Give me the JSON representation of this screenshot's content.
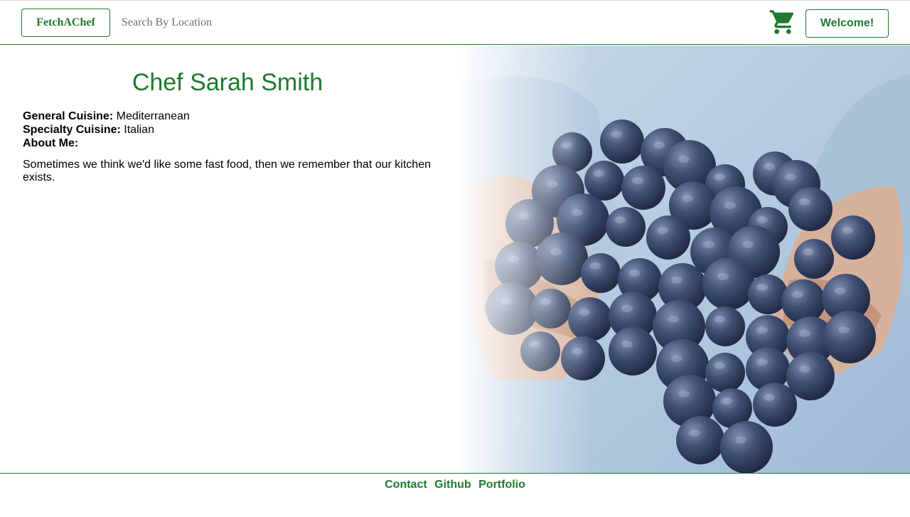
{
  "header": {
    "brand_label": "FetchAChef",
    "search_placeholder": "Search By Location",
    "cart_icon": "shopping-cart-icon",
    "welcome_label": "Welcome!"
  },
  "profile": {
    "name": "Chef Sarah Smith",
    "general_cuisine_label": "General Cuisine:",
    "general_cuisine_value": "Mediterranean",
    "specialty_cuisine_label": "Specialty Cuisine:",
    "specialty_cuisine_value": "Italian",
    "about_label": "About Me:",
    "about_text": "Sometimes we think we'd like some fast food, then we remember that our kitchen exists."
  },
  "footer": {
    "links": [
      "Contact",
      "Github",
      "Portfolio"
    ]
  },
  "colors": {
    "accent": "#1e7a2e",
    "photo_background": "#b8cfe3",
    "grape": "#3b4a6a"
  }
}
